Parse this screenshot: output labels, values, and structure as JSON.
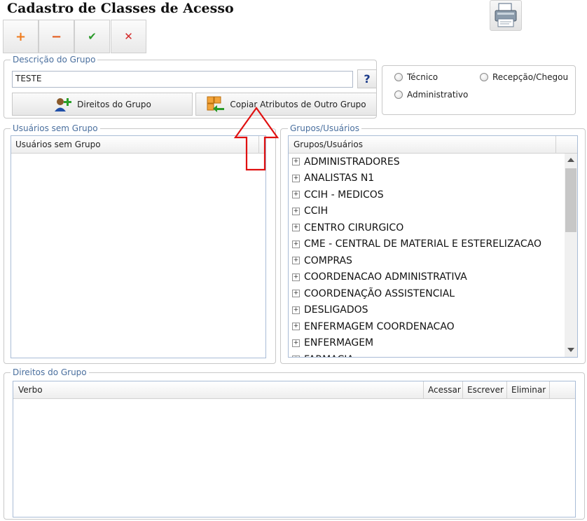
{
  "page_title": "Cadastro de Classes de Acesso",
  "toolbar": {
    "add_symbol": "+",
    "remove_symbol": "−",
    "confirm_symbol": "✔",
    "cancel_symbol": "✕",
    "colors": {
      "add": "#f07a1a",
      "remove": "#e35a1a",
      "confirm": "#2a9a2a",
      "cancel": "#d42a2a"
    }
  },
  "descricao": {
    "legend": "Descrição do Grupo",
    "value": "TESTE",
    "help_symbol": "?",
    "direitos_button": "Direitos do Grupo",
    "copiar_button": "Copiar Atributos de Outro Grupo",
    "radios": [
      {
        "label": "Técnico",
        "checked": false
      },
      {
        "label": "Recepção/Chegou",
        "checked": false
      },
      {
        "label": "Administrativo",
        "checked": false
      }
    ]
  },
  "usuarios_sem_grupo": {
    "legend": "Usuários sem Grupo",
    "column": "Usuários sem Grupo",
    "rows": []
  },
  "grupos_usuarios": {
    "legend": "Grupos/Usuários",
    "column": "Grupos/Usuários",
    "items": [
      "ADMINISTRADORES",
      "ANALISTAS N1",
      "CCIH - MEDICOS",
      "CCIH",
      "CENTRO CIRURGICO",
      "CME - CENTRAL DE MATERIAL E ESTERELIZACAO",
      "COMPRAS",
      "COORDENACAO ADMINISTRATIVA",
      "COORDENAÇÃO ASSISTENCIAL",
      "DESLIGADOS",
      "ENFERMAGEM COORDENACAO",
      "ENFERMAGEM",
      "FARMACIA"
    ]
  },
  "direitos": {
    "legend": "Direitos do Grupo",
    "columns": [
      "Verbo",
      "Acessar",
      "Escrever",
      "Eliminar"
    ]
  },
  "annotation": {
    "arrow_color": "#e01010"
  }
}
